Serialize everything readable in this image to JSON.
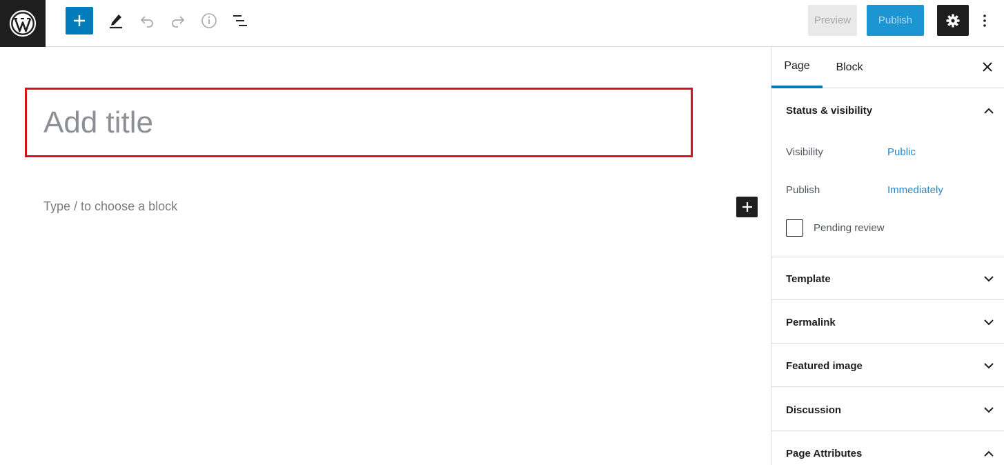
{
  "toolbar": {
    "preview_label": "Preview",
    "publish_label": "Publish"
  },
  "editor": {
    "title_placeholder": "Add title",
    "block_placeholder": "Type / to choose a block"
  },
  "sidebar": {
    "tabs": [
      {
        "label": "Page",
        "active": true
      },
      {
        "label": "Block",
        "active": false
      }
    ],
    "status_visibility": {
      "title": "Status & visibility",
      "expanded": true,
      "rows": [
        {
          "label": "Visibility",
          "value": "Public"
        },
        {
          "label": "Publish",
          "value": "Immediately"
        }
      ],
      "pending_review_label": "Pending review"
    },
    "panels": [
      {
        "title": "Template",
        "expanded": false
      },
      {
        "title": "Permalink",
        "expanded": false
      },
      {
        "title": "Featured image",
        "expanded": false
      },
      {
        "title": "Discussion",
        "expanded": false
      },
      {
        "title": "Page Attributes",
        "expanded": true
      }
    ]
  },
  "colors": {
    "accent": "#007cba",
    "link": "#2a86c5",
    "highlight_border": "#d3141a",
    "dark": "#1e1e1e"
  },
  "icons": [
    "wordpress-logo-icon",
    "plus-icon",
    "pencil-icon",
    "undo-icon",
    "redo-icon",
    "info-icon",
    "list-view-icon",
    "gear-icon",
    "more-vertical-icon",
    "close-icon",
    "chevron-up-icon",
    "chevron-down-icon"
  ]
}
